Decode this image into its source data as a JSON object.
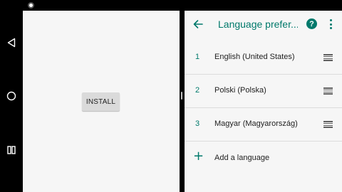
{
  "left_app": {
    "install_label": "INSTALL"
  },
  "nav_bar": {
    "back_icon": "back-triangle-icon",
    "home_icon": "home-circle-icon",
    "recents_icon": "recents-square-icon"
  },
  "settings": {
    "title": "Language prefer...",
    "help_icon": "?",
    "accent_color": "#00796b",
    "languages": [
      {
        "num": "1",
        "name": "English (United States)"
      },
      {
        "num": "2",
        "name": "Polski (Polska)"
      },
      {
        "num": "3",
        "name": "Magyar (Magyarország)"
      }
    ],
    "add_label": "Add a language",
    "add_icon": "+"
  }
}
